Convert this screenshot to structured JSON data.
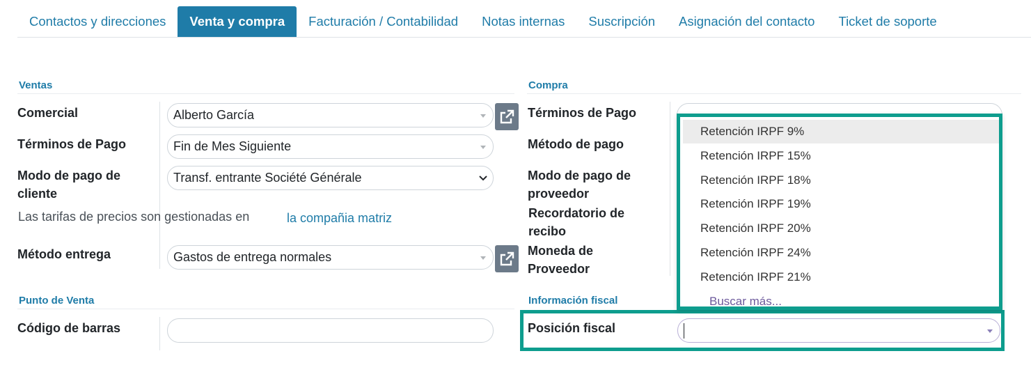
{
  "tabs": [
    {
      "label": "Contactos y direcciones",
      "active": false
    },
    {
      "label": "Venta y compra",
      "active": true
    },
    {
      "label": "Facturación / Contabilidad",
      "active": false
    },
    {
      "label": "Notas internas",
      "active": false
    },
    {
      "label": "Suscripción",
      "active": false
    },
    {
      "label": "Asignación del contacto",
      "active": false
    },
    {
      "label": "Ticket de soporte",
      "active": false
    }
  ],
  "ventas": {
    "title": "Ventas",
    "comercial_label": "Comercial",
    "comercial_value": "Alberto García",
    "terminos_label": "Términos de Pago",
    "terminos_value": "Fin de Mes Siguiente",
    "modo_pago_label_1": "Modo de pago de",
    "modo_pago_label_2": "cliente",
    "modo_pago_value": "Transf. entrante Société Générale",
    "tarifas_text": "Las tarifas de precios son gestionadas en",
    "tarifas_link": "la compañia matriz",
    "metodo_entrega_label": "Método entrega",
    "metodo_entrega_value": "Gastos de entrega normales"
  },
  "punto_venta": {
    "title": "Punto de Venta",
    "codigo_barras_label": "Código de barras",
    "codigo_barras_value": ""
  },
  "compra": {
    "title": "Compra",
    "terminos_label": "Términos de Pago",
    "metodo_pago_label": "Método de pago",
    "modo_pago_label_1": "Modo de pago de",
    "modo_pago_label_2": "proveedor",
    "recordatorio_label_1": "Recordatorio de",
    "recordatorio_label_2": "recibo",
    "moneda_label_1": "Moneda de",
    "moneda_label_2": "Proveedor"
  },
  "fiscal": {
    "title": "Información fiscal",
    "posicion_label": "Posición fiscal",
    "posicion_value": ""
  },
  "dropdown": {
    "items": [
      "Retención IRPF 9%",
      "Retención IRPF 15%",
      "Retención IRPF 18%",
      "Retención IRPF 19%",
      "Retención IRPF 20%",
      "Retención IRPF 24%",
      "Retención IRPF 21%"
    ],
    "more": "Buscar más..."
  },
  "colors": {
    "accent": "#1f7ca8",
    "highlight_frame": "#0e9d8e"
  }
}
